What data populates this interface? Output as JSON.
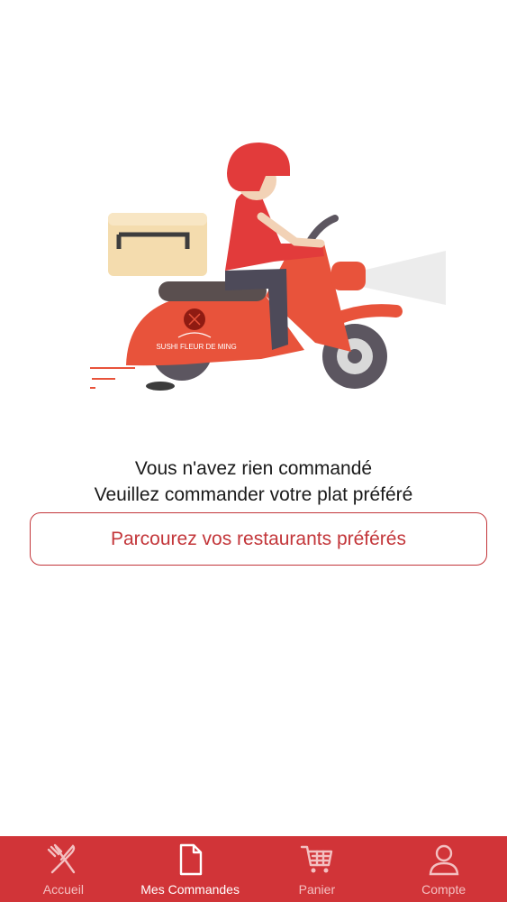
{
  "illustration": {
    "scooter_brand": "SUSHI FLEUR DE MING",
    "colors": {
      "scooter": "#e8533b",
      "helmet": "#e23b3b",
      "box": "#f4dcae",
      "tire": "#5c5660"
    }
  },
  "empty_state": {
    "line1": "Vous n'avez rien commandé",
    "line2": "Veuillez commander votre plat préféré",
    "cta_label": "Parcourez vos restaurants préférés"
  },
  "tabbar": {
    "accent": "#d13438",
    "tabs": [
      {
        "label": "Accueil",
        "icon": "fork-knife-icon",
        "active": false
      },
      {
        "label": "Mes Commandes",
        "icon": "document-icon",
        "active": true
      },
      {
        "label": "Panier",
        "icon": "cart-icon",
        "active": false
      },
      {
        "label": "Compte",
        "icon": "user-icon",
        "active": false
      }
    ]
  }
}
